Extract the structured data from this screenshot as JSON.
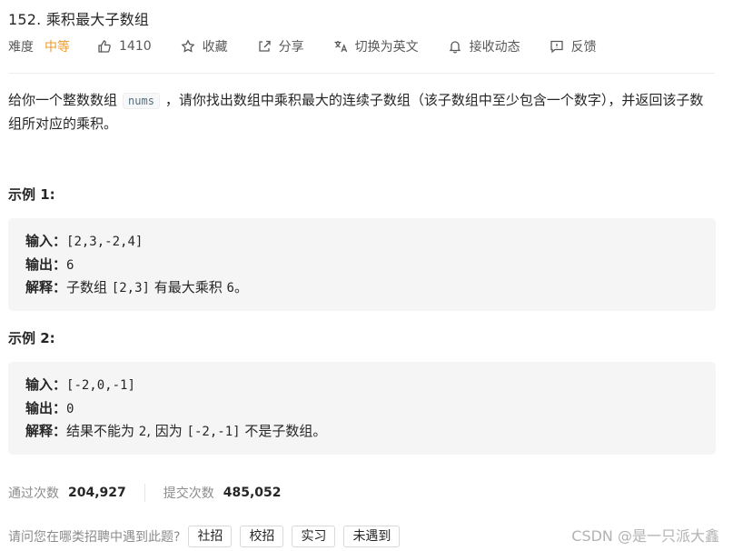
{
  "problem": {
    "title": "152. 乘积最大子数组"
  },
  "meta": {
    "difficulty_label": "难度",
    "difficulty_value": "中等",
    "like_count": "1410",
    "favorite_label": "收藏",
    "share_label": "分享",
    "switch_lang_label": "切换为英文",
    "notify_label": "接收动态",
    "feedback_label": "反馈"
  },
  "description": {
    "part1": "给你一个整数数组",
    "code": "nums",
    "part2": "，请你找出数组中乘积最大的连续子数组（该子数组中至少包含一个数字），并返回该子数组所对应的乘积。"
  },
  "examples": [
    {
      "title": "示例 1:",
      "input_label": "输入：",
      "input_value": "[2,3,-2,4]",
      "output_label": "输出：",
      "output_value": "6",
      "explain_label": "解释：",
      "explain_prefix": "子数组 ",
      "explain_code": "[2,3]",
      "explain_mid": " 有最大乘积 ",
      "explain_num": "6",
      "explain_suffix": "。"
    },
    {
      "title": "示例 2:",
      "input_label": "输入：",
      "input_value": "[-2,0,-1]",
      "output_label": "输出：",
      "output_value": "0",
      "explain_label": "解释：",
      "explain_prefix": "结果不能为 ",
      "explain_code": "2",
      "explain_mid": ", 因为 ",
      "explain_num": "[-2,-1]",
      "explain_suffix": " 不是子数组。"
    }
  ],
  "stats": {
    "accepted_label": "通过次数",
    "accepted_value": "204,927",
    "submitted_label": "提交次数",
    "submitted_value": "485,052"
  },
  "footer": {
    "question": "请问您在哪类招聘中遇到此题?",
    "tags": [
      "社招",
      "校招",
      "实习",
      "未遇到"
    ]
  },
  "watermark": "CSDN @是一只派大鑫",
  "colors": {
    "difficulty_medium": "#ef9a2b",
    "example_bg": "#f5f5f5"
  },
  "icons": [
    "thumbs-up-icon",
    "star-icon",
    "share-icon",
    "translate-icon",
    "bell-icon",
    "feedback-icon"
  ]
}
